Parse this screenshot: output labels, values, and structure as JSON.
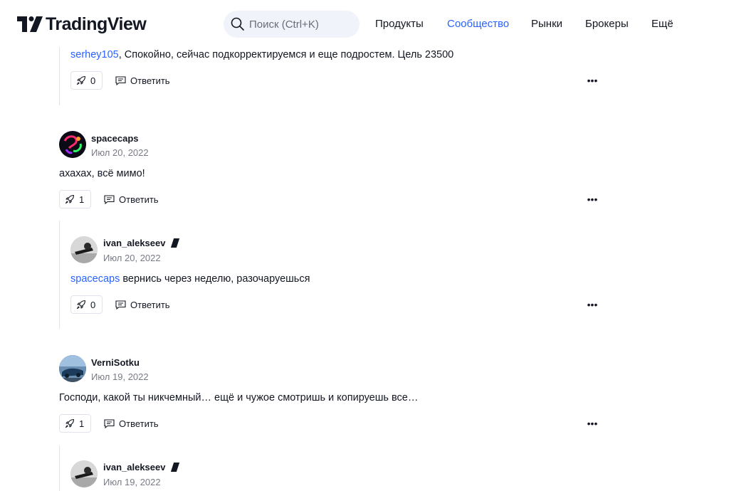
{
  "header": {
    "logo_text": "TradingView",
    "search_placeholder": "Поиск (Ctrl+K)",
    "nav": [
      "Продукты",
      "Сообщество",
      "Рынки",
      "Брокеры",
      "Ещё"
    ],
    "active_nav": "Сообщество",
    "accent_color": "#2962ff"
  },
  "comments": [
    {
      "mention": "serhey105",
      "text": ", Спокойно, сейчас подкорректируемся и еще подростем. Цель 23500",
      "boosts": "0",
      "reply_label": "Ответить"
    },
    {
      "username": "spacecaps",
      "date": "Июл 20, 2022",
      "text": "ахахах, всё мимо!",
      "boosts": "1",
      "reply_label": "Ответить"
    },
    {
      "username": "ivan_alekseev",
      "date": "Июл 20, 2022",
      "mention": "spacecaps",
      "text": " вернись через неделю, разочаруешься",
      "boosts": "0",
      "reply_label": "Ответить"
    },
    {
      "username": "VerniSotku",
      "date": "Июл 19, 2022",
      "text": "Господи, какой ты никчемный… ещё и чужое смотришь и копируешь все…",
      "boosts": "1",
      "reply_label": "Ответить"
    },
    {
      "username": "ivan_alekseev",
      "date": "Июл 19, 2022"
    }
  ]
}
